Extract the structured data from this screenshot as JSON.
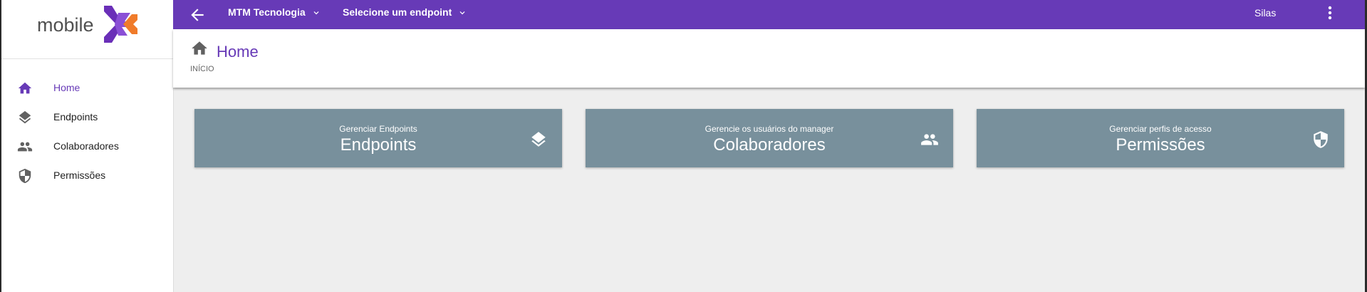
{
  "brand": {
    "logo_text": "mobile",
    "accent": "#673ab7",
    "logo_orange": "#f07b2a"
  },
  "sidebar": {
    "items": [
      {
        "label": "Home",
        "icon": "home-icon",
        "active": true
      },
      {
        "label": "Endpoints",
        "icon": "layers-icon",
        "active": false
      },
      {
        "label": "Colaboradores",
        "icon": "people-icon",
        "active": false
      },
      {
        "label": "Permissões",
        "icon": "shield-icon",
        "active": false
      }
    ]
  },
  "topbar": {
    "company": "MTM Tecnologia",
    "endpoint_select": "Selecione um endpoint",
    "user": "Silas"
  },
  "header": {
    "title": "Home",
    "breadcrumb": "INÍCIO"
  },
  "cards": [
    {
      "subtitle": "Gerenciar Endpoints",
      "title": "Endpoints",
      "icon": "layers-icon"
    },
    {
      "subtitle": "Gerencie os usuários do manager",
      "title": "Colaboradores",
      "icon": "people-icon"
    },
    {
      "subtitle": "Gerenciar perfis de acesso",
      "title": "Permissões",
      "icon": "shield-icon"
    }
  ]
}
